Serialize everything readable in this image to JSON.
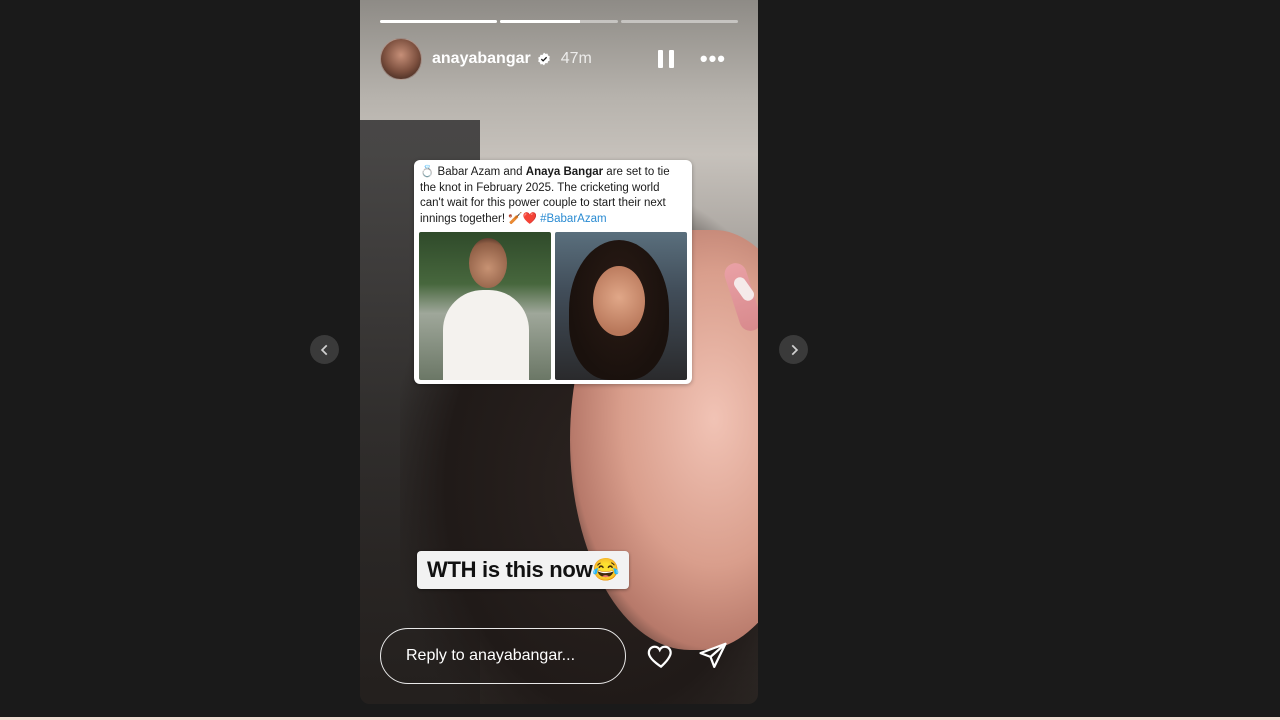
{
  "story": {
    "username": "anayabangar",
    "time": "47m",
    "progress": [
      1,
      0.68,
      0
    ],
    "icons": [
      "verified-badge-icon",
      "pause-icon",
      "more-options-icon",
      "heart-icon",
      "send-icon",
      "chevron-left-icon",
      "chevron-right-icon"
    ]
  },
  "card": {
    "text_1": "Babar Azam and ",
    "text_bold": "Anaya Bangar",
    "text_2": " are set to tie the knot in February 2025. The cricketing world can't wait for this power couple to start their next innings together! 🏏❤️ ",
    "hashtag": "#BabarAzam",
    "ring_emoji": "💍"
  },
  "caption": "WTH is this now😂",
  "reply": {
    "placeholder": "Reply to anayabangar..."
  }
}
